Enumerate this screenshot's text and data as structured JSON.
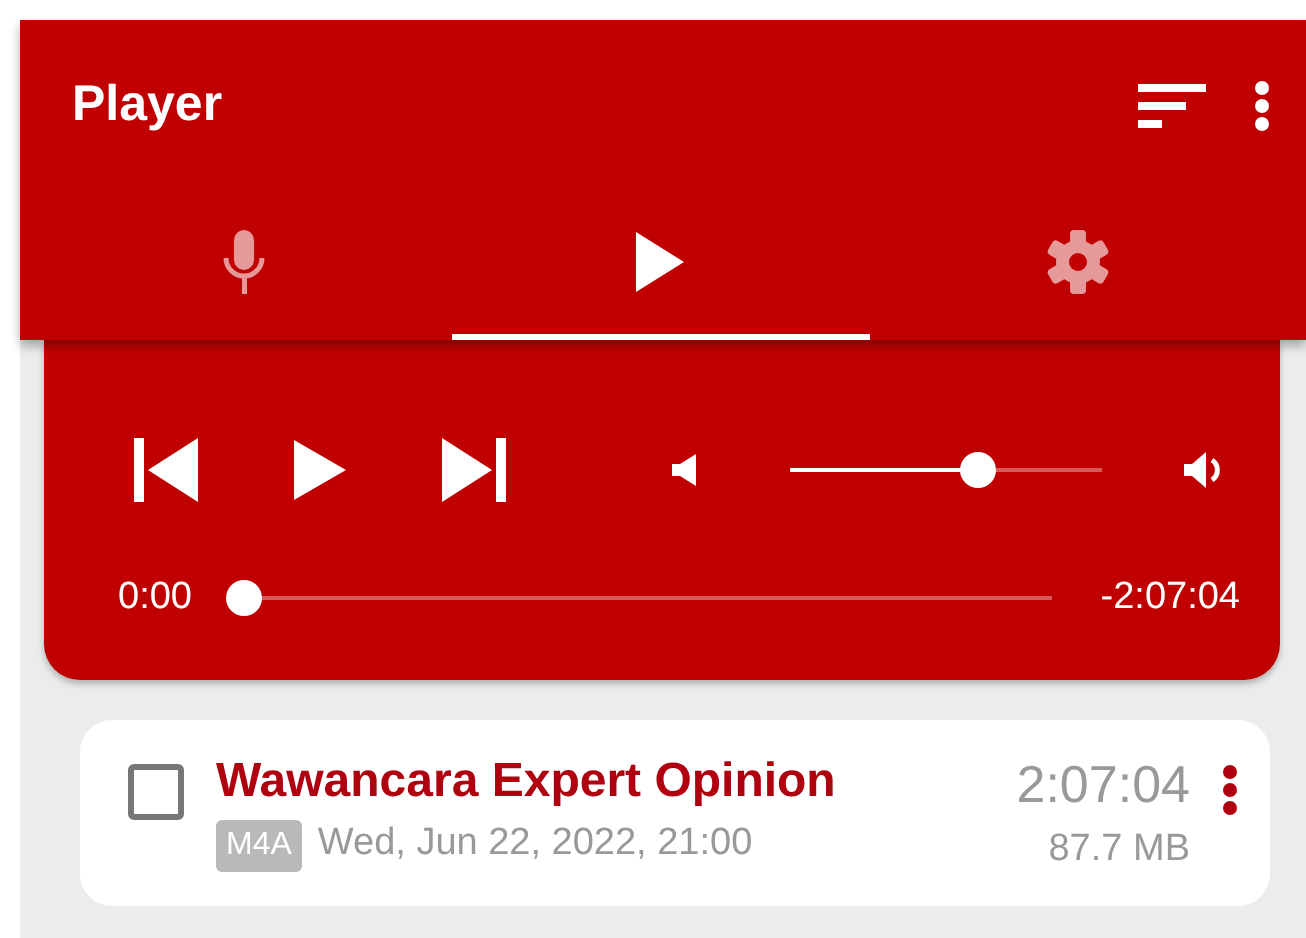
{
  "app_bar": {
    "title": "Player"
  },
  "tabs": [
    {
      "kind": "record",
      "selected": false
    },
    {
      "kind": "play",
      "selected": true
    },
    {
      "kind": "settings",
      "selected": false
    }
  ],
  "player": {
    "volume": {
      "level": 0.6
    },
    "position": {
      "level": 0,
      "elapsed": "0:00",
      "remaining": "-2:07:04"
    }
  },
  "recordings": [
    {
      "title": "Wawancara Expert Opinion",
      "checked": false,
      "format": "M4A",
      "date": "Wed, Jun 22, 2022, 21:00",
      "duration": "2:07:04",
      "size": "87.7 MB"
    }
  ]
}
